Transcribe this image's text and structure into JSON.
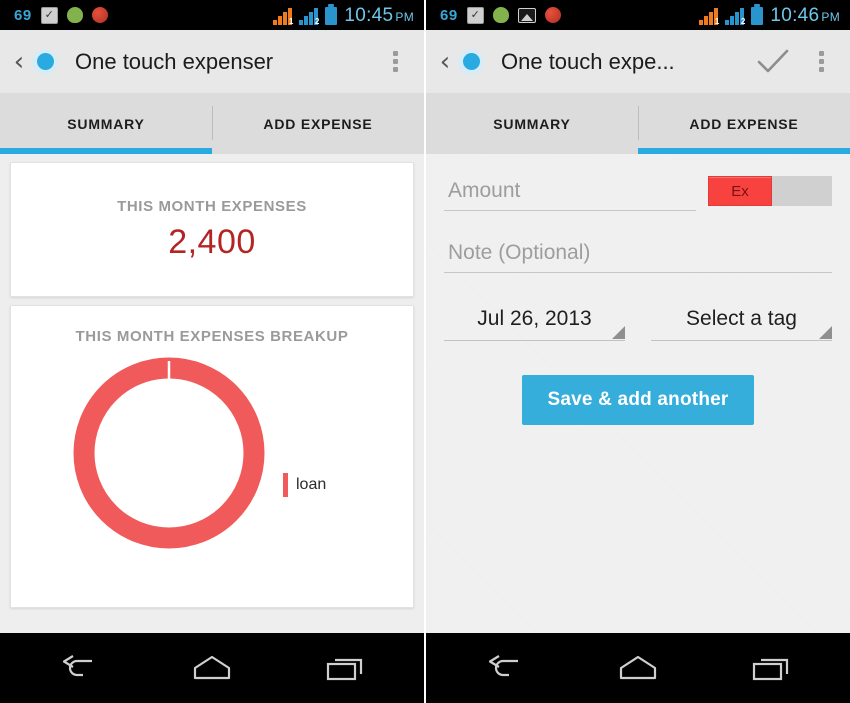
{
  "left": {
    "statusbar": {
      "number": "69",
      "icons": [
        "checkbox-icon",
        "android-icon",
        "red-app-icon"
      ],
      "signal_1_badge": "1",
      "signal_2_badge": "2",
      "time": "10:45",
      "meridiem": "PM"
    },
    "actionbar": {
      "back_label": "‹",
      "app_icon": "blue-circle-app-icon",
      "title": "One touch expenser",
      "overflow_label": "overflow-menu-icon"
    },
    "tabs": [
      {
        "label": "SUMMARY",
        "active": true
      },
      {
        "label": "ADD EXPENSE",
        "active": false
      }
    ],
    "summary": {
      "total_card_label": "THIS MONTH EXPENSES",
      "total_value": "2,400",
      "total_value_color": "#b32525",
      "breakup_card_label": "THIS MONTH EXPENSES BREAKUP",
      "legend": [
        {
          "label": "loan",
          "color": "#F05A5A"
        }
      ]
    },
    "chart_data": {
      "type": "pie",
      "title": "THIS MONTH EXPENSES BREAKUP",
      "categories": [
        "loan"
      ],
      "values": [
        2400
      ],
      "percentages": [
        100
      ],
      "colors": [
        "#F05A5A"
      ],
      "donut": true,
      "legend_position": "right",
      "grid": false
    }
  },
  "right": {
    "statusbar": {
      "number": "69",
      "icons": [
        "checkbox-icon",
        "android-icon",
        "photo-icon",
        "red-app-icon"
      ],
      "signal_1_badge": "1",
      "signal_2_badge": "2",
      "time": "10:46",
      "meridiem": "PM"
    },
    "actionbar": {
      "back_label": "‹",
      "app_icon": "blue-circle-app-icon",
      "title": "One touch expe...",
      "confirm_label": "check-icon",
      "overflow_label": "overflow-menu-icon"
    },
    "tabs": [
      {
        "label": "SUMMARY",
        "active": false
      },
      {
        "label": "ADD EXPENSE",
        "active": true
      }
    ],
    "form": {
      "amount_placeholder": "Amount",
      "amount_value": "",
      "type_toggle_label": "Ex",
      "type_toggle_color": "#F8423F",
      "note_placeholder": "Note (Optional)",
      "note_value": "",
      "date_value": "Jul 26, 2013",
      "tag_value": "Select a tag",
      "save_label": "Save & add another",
      "save_color": "#35AEDC"
    }
  },
  "navbar": {
    "back": "back-icon",
    "home": "home-icon",
    "recents": "recents-icon"
  },
  "theme": {
    "accent": "#29ABE2",
    "tab_bg": "#dcdcdc",
    "actionbar_bg": "#e8e8e8",
    "page_bg": "#eeeeee"
  }
}
